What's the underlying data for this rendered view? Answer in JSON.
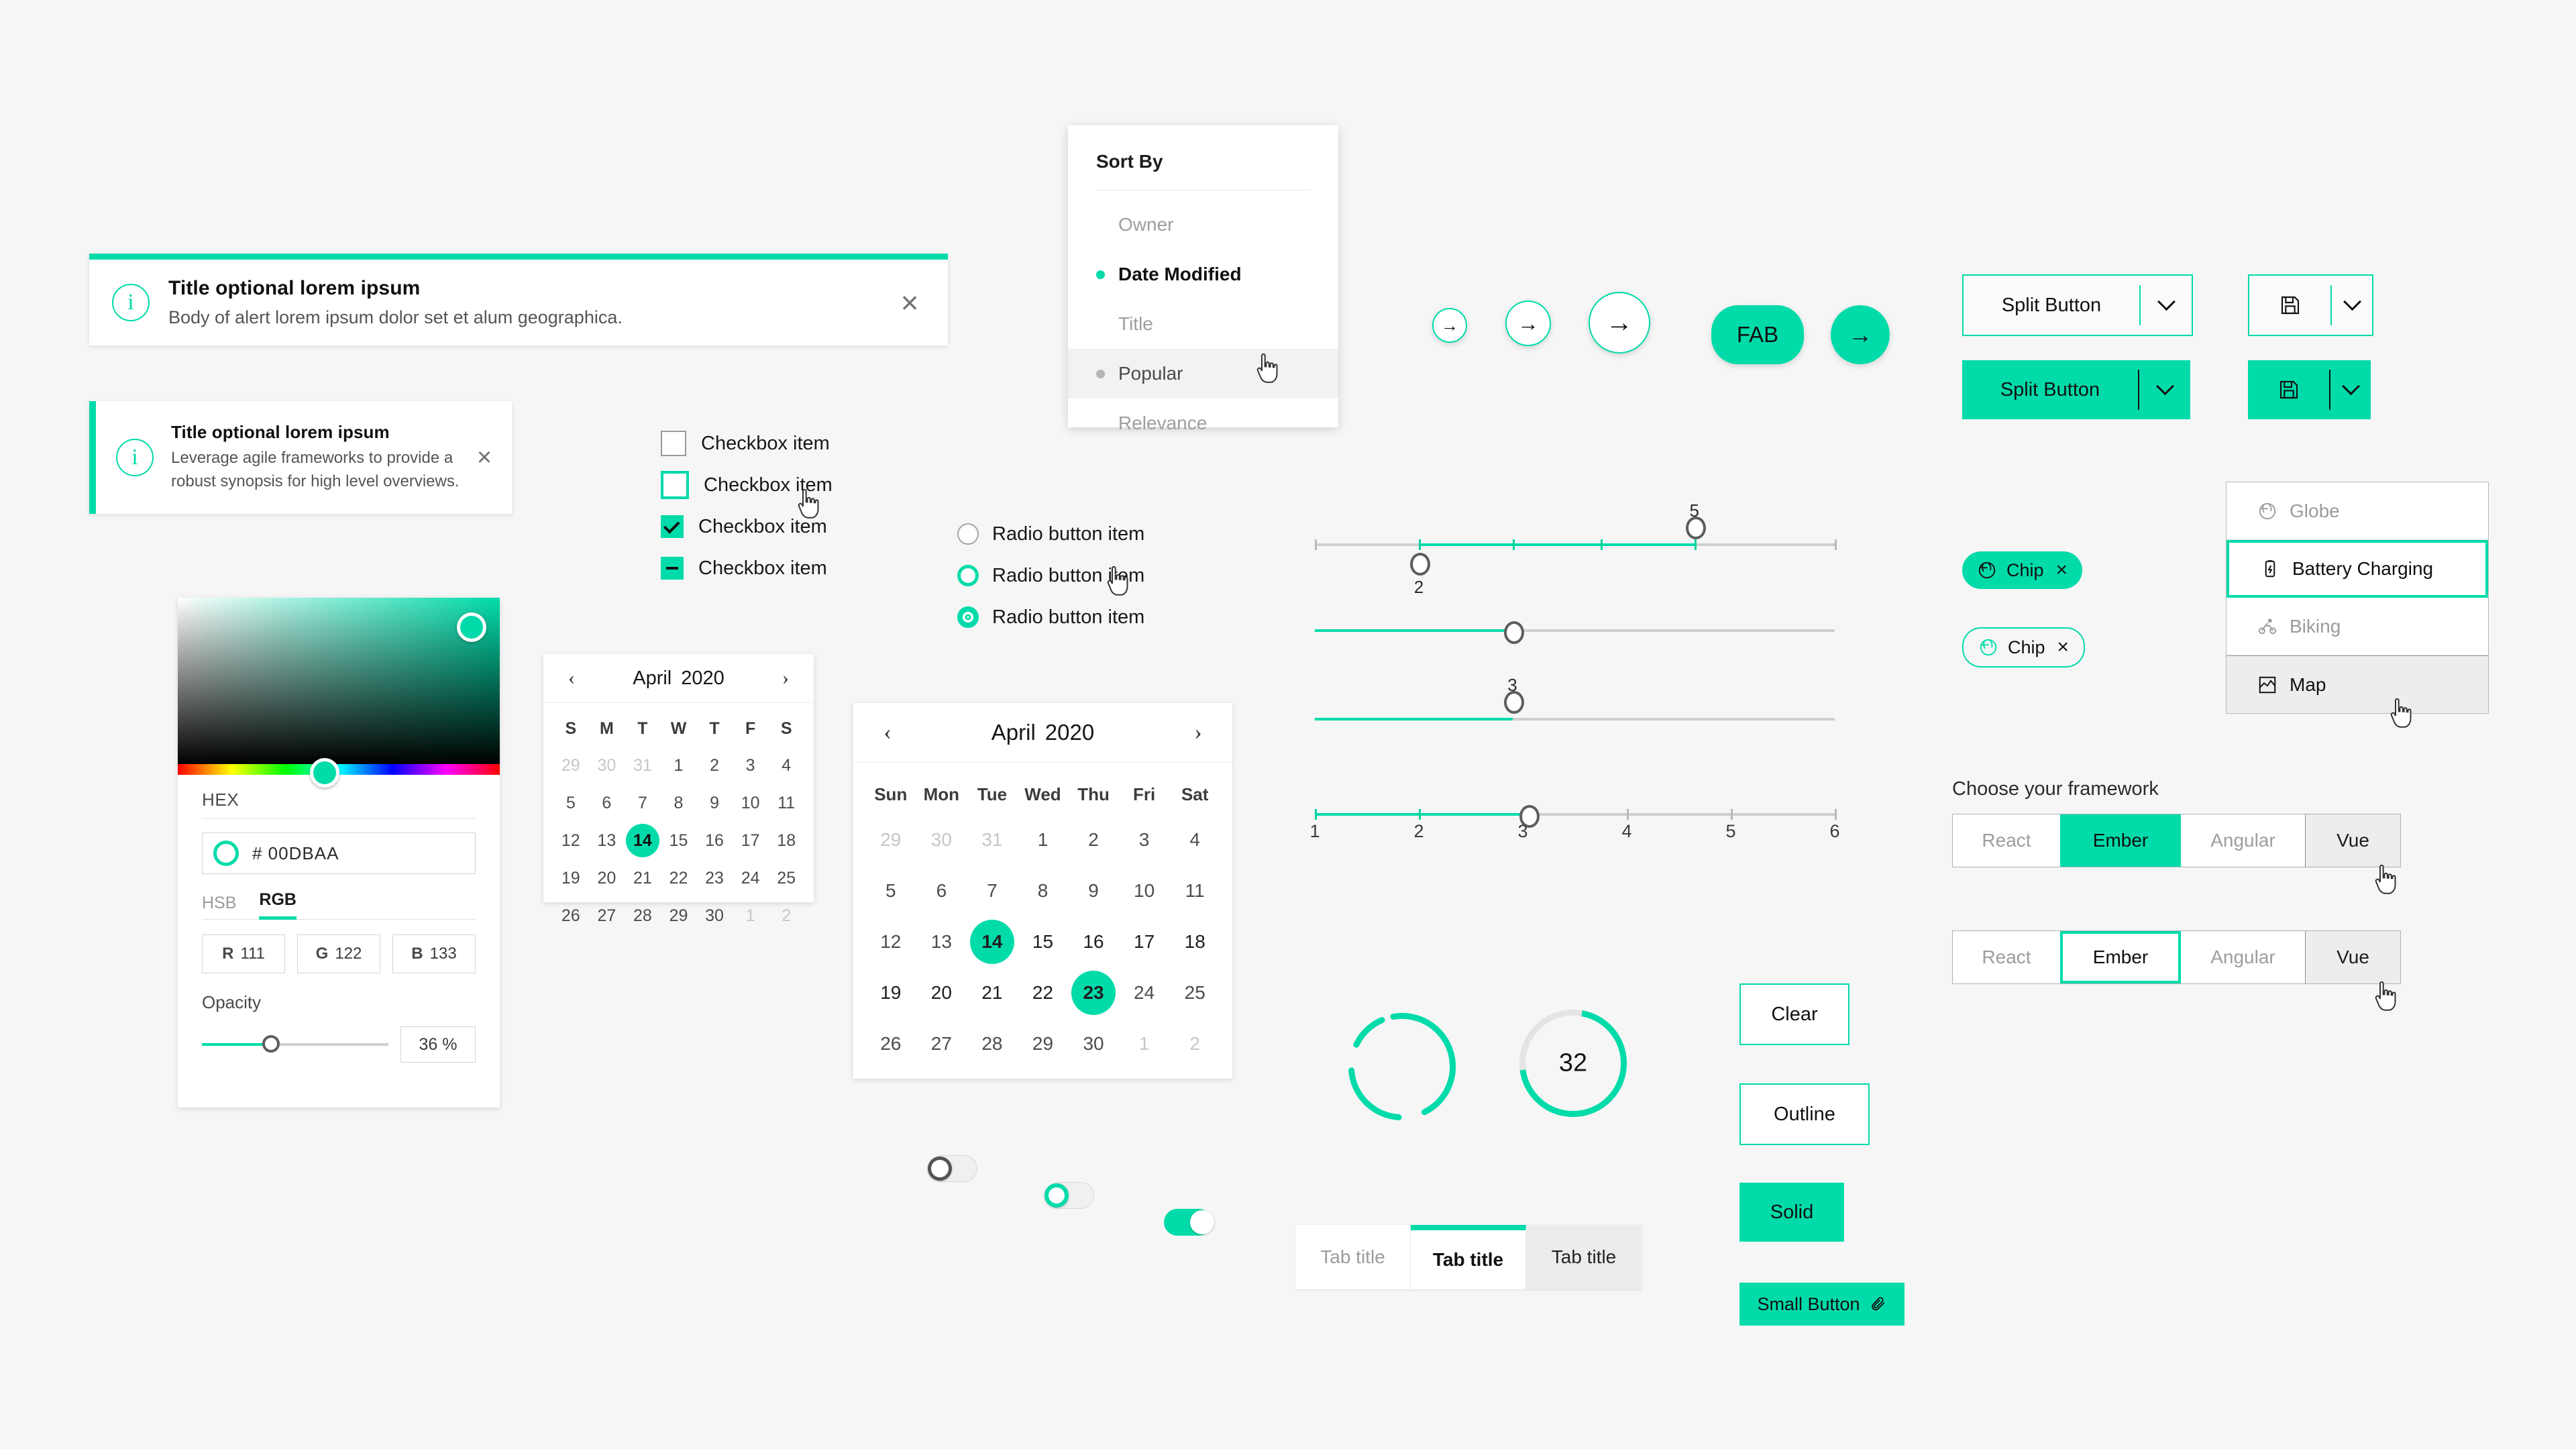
{
  "alerts": [
    {
      "title": "Title optional lorem ipsum",
      "body": "Body of alert lorem ipsum dolor set et alum geographica.",
      "icon": "info-circle-icon",
      "close": "×"
    },
    {
      "title": "Title optional lorem ipsum",
      "body": "Leverage agile frameworks to provide a robust synopsis for high level overviews.",
      "icon": "info-circle-icon",
      "close": "×"
    }
  ],
  "color_picker": {
    "hex_label": "HEX",
    "hex_value": "# 00DBAA",
    "tabs": [
      "HSB",
      "RGB"
    ],
    "active_tab": "RGB",
    "rgb": [
      {
        "key": "R",
        "value": "111"
      },
      {
        "key": "G",
        "value": "122"
      },
      {
        "key": "B",
        "value": "133"
      }
    ],
    "opacity_label": "Opacity",
    "opacity_value": "36 %",
    "opacity_percent": 37,
    "accent": "#00dba9"
  },
  "checkboxes": [
    {
      "label": "Checkbox item",
      "state": "empty"
    },
    {
      "label": "Checkbox item",
      "state": "outline"
    },
    {
      "label": "Checkbox item",
      "state": "checked"
    },
    {
      "label": "Checkbox item",
      "state": "indeterminate"
    }
  ],
  "radios": [
    {
      "label": "Radio button item",
      "state": "empty"
    },
    {
      "label": "Radio button item",
      "state": "hover"
    },
    {
      "label": "Radio button item",
      "state": "selected"
    }
  ],
  "sort_by": {
    "title": "Sort By",
    "items": [
      {
        "label": "Owner",
        "selected": false,
        "hovered": false
      },
      {
        "label": "Date Modified",
        "selected": true,
        "hovered": false
      },
      {
        "label": "Title",
        "selected": false,
        "hovered": false
      },
      {
        "label": "Popular",
        "selected": false,
        "hovered": true
      },
      {
        "label": "Relevance",
        "selected": false,
        "hovered": false
      }
    ]
  },
  "calendar_small": {
    "month": "April",
    "year": "2020",
    "prev": "‹",
    "next": "›",
    "dow": [
      "S",
      "M",
      "T",
      "W",
      "T",
      "F",
      "S"
    ],
    "weeks": [
      [
        {
          "d": "29",
          "muted": true
        },
        {
          "d": "30",
          "muted": true
        },
        {
          "d": "31",
          "muted": true
        },
        {
          "d": "1"
        },
        {
          "d": "2"
        },
        {
          "d": "3"
        },
        {
          "d": "4"
        }
      ],
      [
        {
          "d": "5"
        },
        {
          "d": "6"
        },
        {
          "d": "7"
        },
        {
          "d": "8"
        },
        {
          "d": "9"
        },
        {
          "d": "10"
        },
        {
          "d": "11"
        }
      ],
      [
        {
          "d": "12"
        },
        {
          "d": "13"
        },
        {
          "d": "14",
          "selected": true
        },
        {
          "d": "15"
        },
        {
          "d": "16"
        },
        {
          "d": "17"
        },
        {
          "d": "18"
        }
      ],
      [
        {
          "d": "19"
        },
        {
          "d": "20"
        },
        {
          "d": "21"
        },
        {
          "d": "22"
        },
        {
          "d": "23"
        },
        {
          "d": "24"
        },
        {
          "d": "25"
        }
      ],
      [
        {
          "d": "26"
        },
        {
          "d": "27"
        },
        {
          "d": "28"
        },
        {
          "d": "29"
        },
        {
          "d": "30"
        },
        {
          "d": "1",
          "muted": true
        },
        {
          "d": "2",
          "muted": true
        }
      ]
    ]
  },
  "calendar_large": {
    "month": "April",
    "year": "2020",
    "prev": "‹",
    "next": "›",
    "dow": [
      "Sun",
      "Mon",
      "Tue",
      "Wed",
      "Thu",
      "Fri",
      "Sat"
    ],
    "weeks": [
      [
        {
          "d": "29",
          "muted": true
        },
        {
          "d": "30",
          "muted": true
        },
        {
          "d": "31",
          "muted": true
        },
        {
          "d": "1"
        },
        {
          "d": "2"
        },
        {
          "d": "3"
        },
        {
          "d": "4"
        }
      ],
      [
        {
          "d": "5"
        },
        {
          "d": "6"
        },
        {
          "d": "7"
        },
        {
          "d": "8"
        },
        {
          "d": "9"
        },
        {
          "d": "10"
        },
        {
          "d": "11"
        }
      ],
      [
        {
          "d": "12"
        },
        {
          "d": "13"
        },
        {
          "d": "14",
          "selected": true,
          "range": true,
          "range_start": true
        },
        {
          "d": "15",
          "range": true
        },
        {
          "d": "16",
          "range": true
        },
        {
          "d": "17",
          "range": true
        },
        {
          "d": "18",
          "range": true,
          "range_end": true
        }
      ],
      [
        {
          "d": "19",
          "range": true,
          "range_start": true
        },
        {
          "d": "20",
          "range": true
        },
        {
          "d": "21",
          "range": true
        },
        {
          "d": "22",
          "range": true
        },
        {
          "d": "23",
          "selected": true,
          "range": true,
          "range_end": true
        },
        {
          "d": "24"
        },
        {
          "d": "25"
        }
      ],
      [
        {
          "d": "26"
        },
        {
          "d": "27"
        },
        {
          "d": "28"
        },
        {
          "d": "29"
        },
        {
          "d": "30"
        },
        {
          "d": "1",
          "muted": true
        },
        {
          "d": "2",
          "muted": true
        }
      ]
    ]
  },
  "sliders": [
    {
      "type": "range-ticks",
      "low_value": "2",
      "high_value": "5",
      "low_pct": 20,
      "high_pct": 73,
      "ticks": [
        0,
        20,
        38,
        55,
        73,
        100
      ]
    },
    {
      "type": "simple",
      "value_pct": 38
    },
    {
      "type": "labeled",
      "value": "3",
      "value_pct": 38
    },
    {
      "type": "scale",
      "value_pct": 41,
      "ticks": [
        0,
        20,
        40,
        60,
        80,
        100
      ],
      "scale_labels": [
        "1",
        "2",
        "3",
        "4",
        "5",
        "6"
      ]
    }
  ],
  "round_buttons": [
    {
      "icon": "arrow-right-icon",
      "size": 44
    },
    {
      "icon": "arrow-right-icon",
      "size": 58
    },
    {
      "icon": "arrow-right-icon",
      "size": 74
    }
  ],
  "fab": {
    "label": "FAB",
    "icon_label": "→"
  },
  "split_buttons": [
    {
      "label": "Split Button",
      "style": "outline",
      "caret": "chevron-down-icon"
    },
    {
      "label": "Split Button",
      "style": "solid",
      "caret": "chevron-down-icon"
    }
  ],
  "icon_split_buttons": [
    {
      "icon": "save-floppy-icon",
      "style": "outline",
      "caret": "chevron-down-icon"
    },
    {
      "icon": "save-floppy-icon",
      "style": "solid",
      "caret": "chevron-down-icon"
    }
  ],
  "chips": [
    {
      "label": "Chip",
      "icon": "globe-icon",
      "style": "solid",
      "close": "×"
    },
    {
      "label": "Chip",
      "icon": "globe-icon",
      "style": "outline",
      "close": "×"
    }
  ],
  "list_group": [
    {
      "label": "Globe",
      "icon": "globe-icon",
      "state": "default"
    },
    {
      "label": "Battery Charging",
      "icon": "battery-charging-icon",
      "state": "active"
    },
    {
      "label": "Biking",
      "icon": "biking-icon",
      "state": "default"
    },
    {
      "label": "Map",
      "icon": "map-icon",
      "state": "hovered"
    }
  ],
  "segmented": {
    "label": "Choose your framework",
    "rows": [
      {
        "style": "solid",
        "options": [
          {
            "label": "React",
            "state": "default"
          },
          {
            "label": "Ember",
            "state": "selected"
          },
          {
            "label": "Angular",
            "state": "default"
          },
          {
            "label": "Vue",
            "state": "hovered"
          }
        ]
      },
      {
        "style": "outline",
        "options": [
          {
            "label": "React",
            "state": "default"
          },
          {
            "label": "Ember",
            "state": "selected"
          },
          {
            "label": "Angular",
            "state": "default"
          },
          {
            "label": "Vue",
            "state": "hovered"
          }
        ]
      }
    ]
  },
  "buttons": [
    {
      "label": "Clear",
      "style": "outline"
    },
    {
      "label": "Outline",
      "style": "outline"
    },
    {
      "label": "Solid",
      "style": "solid"
    },
    {
      "label": "Small Button",
      "style": "solid-small",
      "icon": "paperclip-icon"
    }
  ],
  "toggles": [
    {
      "state": "off"
    },
    {
      "state": "off-focus"
    },
    {
      "state": "on"
    }
  ],
  "tabs": [
    {
      "label": "Tab title",
      "state": "default"
    },
    {
      "label": "Tab title",
      "state": "active"
    },
    {
      "label": "Tab title",
      "state": "hovered"
    }
  ],
  "progress": [
    {
      "type": "indeterminate-ring"
    },
    {
      "type": "determinate-ring",
      "value": "32",
      "percent": 70
    }
  ],
  "theme": {
    "accent": "#00dba9",
    "accent_light": "#dcfaf1",
    "background": "#f6f6f6",
    "surface": "#ffffff",
    "text": "#151515",
    "muted": "#9b9b9b"
  }
}
